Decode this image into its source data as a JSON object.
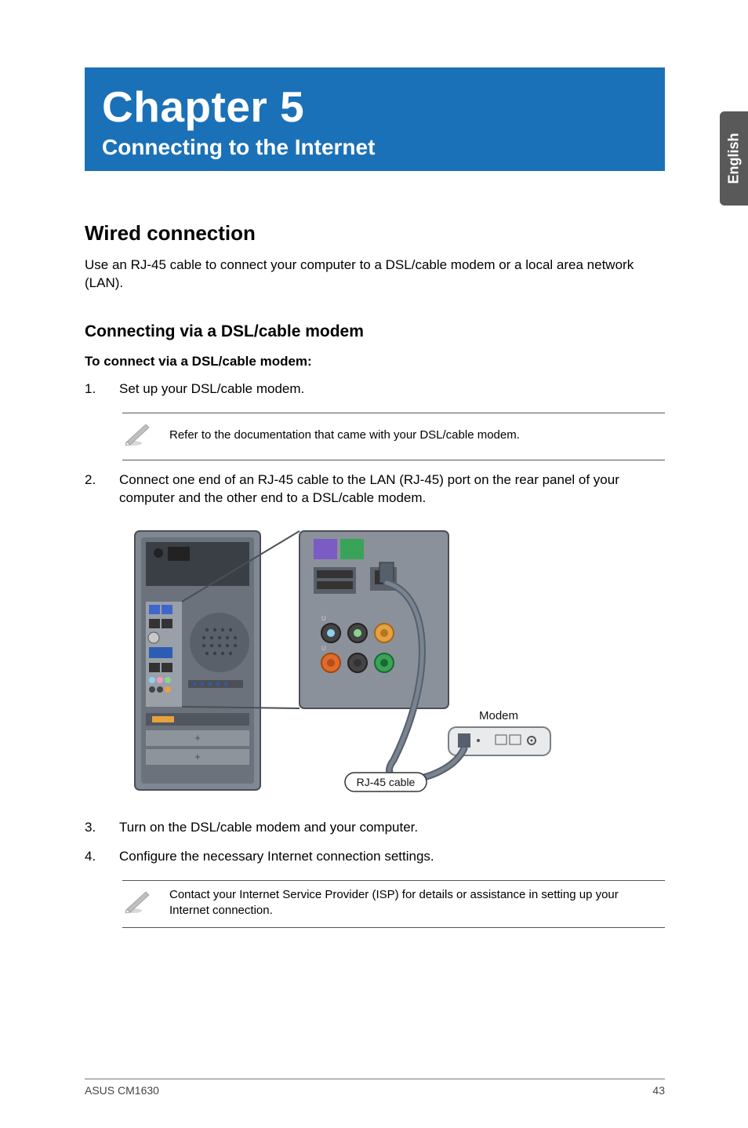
{
  "sideTab": "English",
  "banner": {
    "chapter": "Chapter 5",
    "title": "Connecting to the Internet"
  },
  "section": {
    "heading": "Wired connection",
    "intro": "Use an RJ-45 cable to connect your computer to a DSL/cable modem or a local area network (LAN).",
    "subheading": "Connecting via a DSL/cable modem",
    "boldLine": "To connect via a DSL/cable modem:",
    "steps": {
      "s1_num": "1.",
      "s1": "Set up your DSL/cable modem.",
      "note1": "Refer to the documentation that came with your DSL/cable modem.",
      "s2_num": "2.",
      "s2": "Connect one end of an RJ-45 cable to the LAN (RJ-45) port on the rear panel of your computer and the other end to a DSL/cable modem.",
      "s3_num": "3.",
      "s3": "Turn on the DSL/cable modem and your computer.",
      "s4_num": "4.",
      "s4": "Configure the necessary Internet connection settings.",
      "note2": "Contact your Internet Service Provider (ISP) for details or assistance in setting up your Internet connection."
    }
  },
  "diagram": {
    "modemLabel": "Modem",
    "cableLabel": "RJ-45 cable"
  },
  "footer": {
    "left": "ASUS CM1630",
    "right": "43"
  }
}
